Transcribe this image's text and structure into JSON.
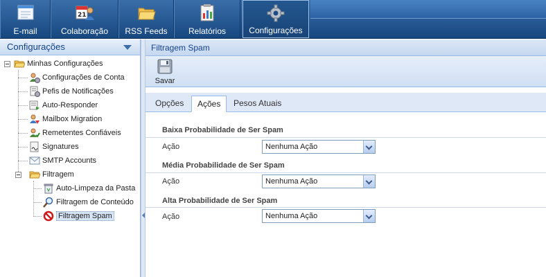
{
  "nav": {
    "items": [
      {
        "label": "E-mail",
        "icon": "mail-icon"
      },
      {
        "label": "Colaboração",
        "icon": "calendar-contacts-icon",
        "calendar_day": "21"
      },
      {
        "label": "RSS Feeds",
        "icon": "folder-icon"
      },
      {
        "label": "Relatórios",
        "icon": "report-icon"
      },
      {
        "label": "Configurações",
        "icon": "gear-icon",
        "active": true
      }
    ]
  },
  "sidebar": {
    "title": "Configurações",
    "root": "Minhas Configurações",
    "items": [
      {
        "label": "Configurações de Conta",
        "icon": "account-settings-icon"
      },
      {
        "label": "Pefis de Notificações",
        "icon": "notification-profile-icon"
      },
      {
        "label": "Auto-Responder",
        "icon": "auto-responder-icon"
      },
      {
        "label": "Mailbox Migration",
        "icon": "mailbox-migration-icon"
      },
      {
        "label": "Remetentes Confiáveis",
        "icon": "trusted-senders-icon"
      },
      {
        "label": "Signatures",
        "icon": "signature-icon"
      },
      {
        "label": "SMTP Accounts",
        "icon": "smtp-icon"
      }
    ],
    "filter_folder": "Filtragem",
    "filter_items": [
      {
        "label": "Auto-Limpeza da Pasta",
        "icon": "trash-icon"
      },
      {
        "label": "Filtragem de Conteúdo",
        "icon": "magnifier-icon"
      },
      {
        "label": "Filtragem Spam",
        "icon": "no-entry-icon",
        "selected": true
      }
    ]
  },
  "main": {
    "title": "Filtragem Spam",
    "toolbar": {
      "save_label": "Savar"
    },
    "tabs": [
      {
        "label": "Opções"
      },
      {
        "label": "Ações",
        "active": true
      },
      {
        "label": "Pesos Atuais"
      }
    ],
    "sections": [
      {
        "title": "Baixa Probabilidade de Ser Spam",
        "field_label": "Ação",
        "value": "Nenhuma Ação"
      },
      {
        "title": "Média Probabilidade de Ser Spam",
        "field_label": "Ação",
        "value": "Nenhuma Ação"
      },
      {
        "title": "Alta Probabilidade de Ser Spam",
        "field_label": "Ação",
        "value": "Nenhuma Ação"
      }
    ]
  }
}
